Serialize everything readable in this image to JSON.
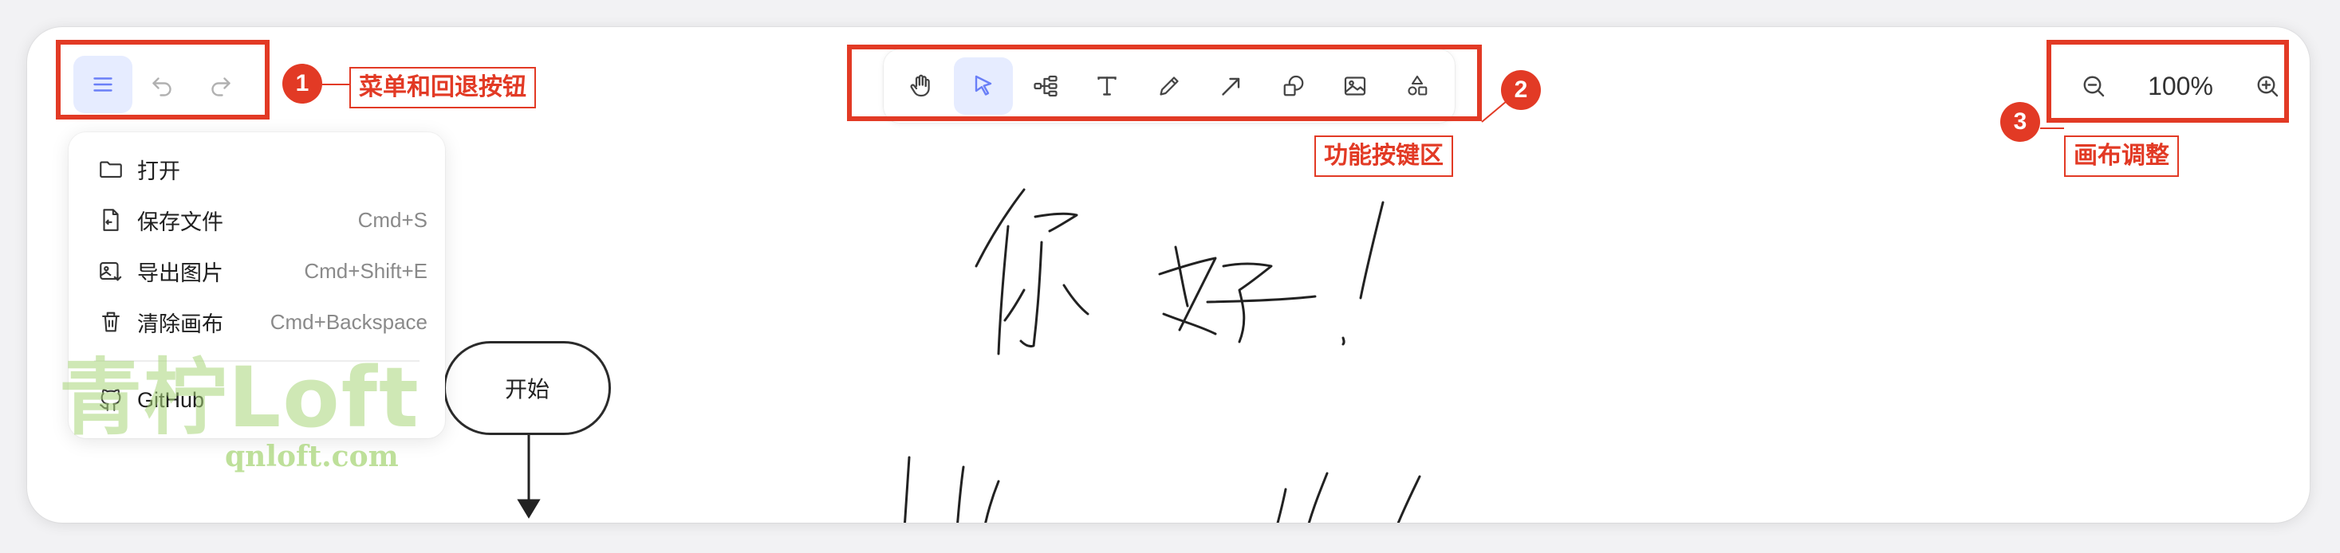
{
  "toolbar_left": {
    "menu_icon": "hamburger-icon",
    "undo_icon": "undo-icon",
    "redo_icon": "redo-icon"
  },
  "tools": [
    {
      "name": "hand",
      "icon": "hand-icon",
      "active": false
    },
    {
      "name": "select",
      "icon": "pointer-icon",
      "active": true
    },
    {
      "name": "mindmap",
      "icon": "mindmap-icon",
      "active": false
    },
    {
      "name": "text",
      "icon": "text-icon",
      "active": false
    },
    {
      "name": "pencil",
      "icon": "pencil-icon",
      "active": false
    },
    {
      "name": "arrow",
      "icon": "arrow-icon",
      "active": false
    },
    {
      "name": "shape",
      "icon": "shape-icon",
      "active": false
    },
    {
      "name": "image",
      "icon": "image-icon",
      "active": false
    },
    {
      "name": "extras",
      "icon": "shapes-extra-icon",
      "active": false
    }
  ],
  "zoom": {
    "value": "100%"
  },
  "menu": {
    "items": [
      {
        "label": "打开",
        "shortcut": "",
        "icon": "folder-icon"
      },
      {
        "label": "保存文件",
        "shortcut": "Cmd+S",
        "icon": "save-file-icon"
      },
      {
        "label": "导出图片",
        "shortcut": "Cmd+Shift+E",
        "icon": "export-image-icon"
      },
      {
        "label": "清除画布",
        "shortcut": "Cmd+Backspace",
        "icon": "trash-icon"
      }
    ],
    "github": {
      "label": "GitHub",
      "icon": "github-icon"
    }
  },
  "canvas": {
    "start_node": "开始",
    "handwriting": "你好！"
  },
  "annotations": [
    {
      "number": "1",
      "label": "菜单和回退按钮"
    },
    {
      "number": "2",
      "label": "功能按键区"
    },
    {
      "number": "3",
      "label": "画布调整"
    }
  ],
  "watermark": {
    "main": "青柠Loft",
    "sub": "qnloft.com"
  },
  "colors": {
    "accent": "#e6ecff",
    "active_icon": "#6a7ff7",
    "annotation": "#e23a25"
  }
}
